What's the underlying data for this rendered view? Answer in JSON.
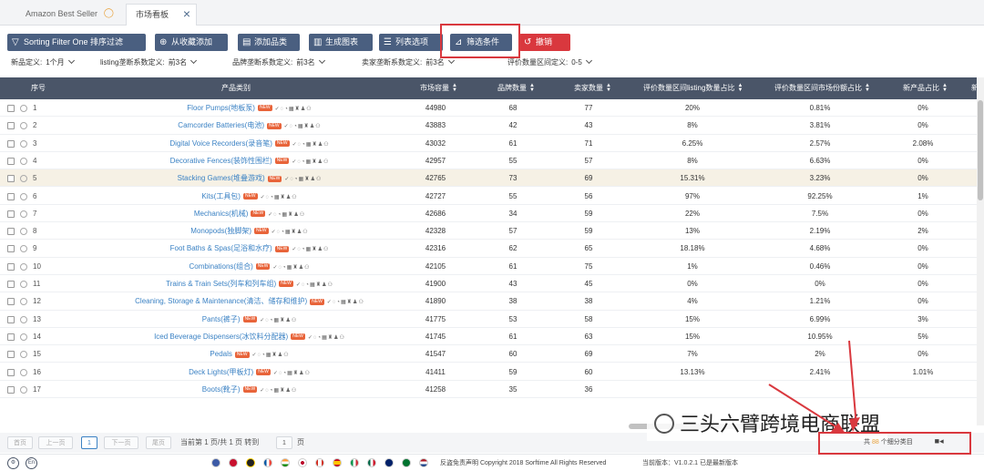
{
  "tabs": [
    {
      "label": "Amazon Best Seller",
      "icon": "star-icon"
    },
    {
      "label": "市场看板",
      "icon": "close-icon"
    }
  ],
  "toolbar": [
    {
      "label": "Sorting Filter One 排序过滤",
      "icon": "filter-icon"
    },
    {
      "label": "从收藏添加",
      "icon": "add-icon"
    },
    {
      "label": "添加品类",
      "icon": "document-icon"
    },
    {
      "label": "生成图表",
      "icon": "chart-icon"
    },
    {
      "label": "列表选项",
      "icon": "list-icon"
    },
    {
      "label": "筛选条件",
      "icon": "filter-condition-icon"
    },
    {
      "label": "撤销",
      "icon": "undo-icon"
    }
  ],
  "defs": [
    {
      "label": "新品定义:",
      "value": "1个月"
    },
    {
      "label": "listing垄断系数定义:",
      "value": "前3名"
    },
    {
      "label": "品牌垄断系数定义:",
      "value": "前3名"
    },
    {
      "label": "卖家垄断系数定义:",
      "value": "前3名"
    },
    {
      "label": "评价数量区间定义:",
      "value": "0-5"
    }
  ],
  "columns": [
    "序号",
    "产品类别",
    "市场容量",
    "品牌数量",
    "卖家数量",
    "评价数量区间listing数量占比",
    "评价数量区间市场份额占比",
    "新产品占比",
    "新"
  ],
  "rows": [
    {
      "n": "1",
      "name": "Floor Pumps(地板泵)",
      "cap": "44980",
      "brand": "68",
      "seller": "77",
      "lst": "20%",
      "share": "0.81%",
      "newp": "0%"
    },
    {
      "n": "2",
      "name": "Camcorder Batteries(电池)",
      "cap": "43883",
      "brand": "42",
      "seller": "43",
      "lst": "8%",
      "share": "3.81%",
      "newp": "0%"
    },
    {
      "n": "3",
      "name": "Digital Voice Recorders(录音笔)",
      "cap": "43032",
      "brand": "61",
      "seller": "71",
      "lst": "6.25%",
      "share": "2.57%",
      "newp": "2.08%"
    },
    {
      "n": "4",
      "name": "Decorative Fences(装饰性围栏)",
      "cap": "42957",
      "brand": "55",
      "seller": "57",
      "lst": "8%",
      "share": "6.63%",
      "newp": "0%"
    },
    {
      "n": "5",
      "name": "Stacking Games(堆叠游戏)",
      "cap": "42765",
      "brand": "73",
      "seller": "69",
      "lst": "15.31%",
      "share": "3.23%",
      "newp": "0%"
    },
    {
      "n": "6",
      "name": "Kits(工具包)",
      "cap": "42727",
      "brand": "55",
      "seller": "56",
      "lst": "97%",
      "share": "92.25%",
      "newp": "1%"
    },
    {
      "n": "7",
      "name": "Mechanics(机械)",
      "cap": "42686",
      "brand": "34",
      "seller": "59",
      "lst": "22%",
      "share": "7.5%",
      "newp": "0%"
    },
    {
      "n": "8",
      "name": "Monopods(独脚架)",
      "cap": "42328",
      "brand": "57",
      "seller": "59",
      "lst": "13%",
      "share": "2.19%",
      "newp": "2%"
    },
    {
      "n": "9",
      "name": "Foot Baths & Spas(足浴和水疗)",
      "cap": "42316",
      "brand": "62",
      "seller": "65",
      "lst": "18.18%",
      "share": "4.68%",
      "newp": "0%"
    },
    {
      "n": "10",
      "name": "Combinations(组合)",
      "cap": "42105",
      "brand": "61",
      "seller": "75",
      "lst": "1%",
      "share": "0.46%",
      "newp": "0%"
    },
    {
      "n": "11",
      "name": "Trains & Train Sets(列车和列车组)",
      "cap": "41900",
      "brand": "43",
      "seller": "45",
      "lst": "0%",
      "share": "0%",
      "newp": "0%"
    },
    {
      "n": "12",
      "name": "Cleaning, Storage & Maintenance(清洁、储存和维护)",
      "cap": "41890",
      "brand": "38",
      "seller": "38",
      "lst": "4%",
      "share": "1.21%",
      "newp": "0%"
    },
    {
      "n": "13",
      "name": "Pants(裤子)",
      "cap": "41775",
      "brand": "53",
      "seller": "58",
      "lst": "15%",
      "share": "6.99%",
      "newp": "3%"
    },
    {
      "n": "14",
      "name": "Iced Beverage Dispensers(冰饮料分配器)",
      "cap": "41745",
      "brand": "61",
      "seller": "63",
      "lst": "15%",
      "share": "10.95%",
      "newp": "5%"
    },
    {
      "n": "15",
      "name": "Pedals",
      "cap": "41547",
      "brand": "60",
      "seller": "69",
      "lst": "7%",
      "share": "2%",
      "newp": "0%"
    },
    {
      "n": "16",
      "name": "Deck Lights(甲板灯)",
      "cap": "41411",
      "brand": "59",
      "seller": "60",
      "lst": "13.13%",
      "share": "2.41%",
      "newp": "1.01%"
    },
    {
      "n": "17",
      "name": "Boots(靴子)",
      "cap": "41258",
      "brand": "35",
      "seller": "36",
      "lst": "",
      "share": "",
      "newp": ""
    }
  ],
  "new_tag": "NEW",
  "pager": {
    "first": "首页",
    "prev": "上一页",
    "current": "1",
    "next": "下一页",
    "last": "尾页",
    "info": "当前第 1 页/共 1 页  转到",
    "goto_value": "1",
    "goto_unit": "页"
  },
  "stat": {
    "prefix": "共",
    "count": "88",
    "suffix": "个细分类目"
  },
  "watermark": "三头六臂跨境电商联盟",
  "footer": {
    "disclaimer": "反盗免责声明 Copyright 2018 Sorftime All Rights Reserved",
    "version": "当前版本：V1.0.2.1  已是最新版本",
    "lang": "En"
  },
  "colors": {
    "header": "#4a5568",
    "button": "#4a5f80",
    "danger": "#d9383e",
    "link": "#3b82c4"
  }
}
